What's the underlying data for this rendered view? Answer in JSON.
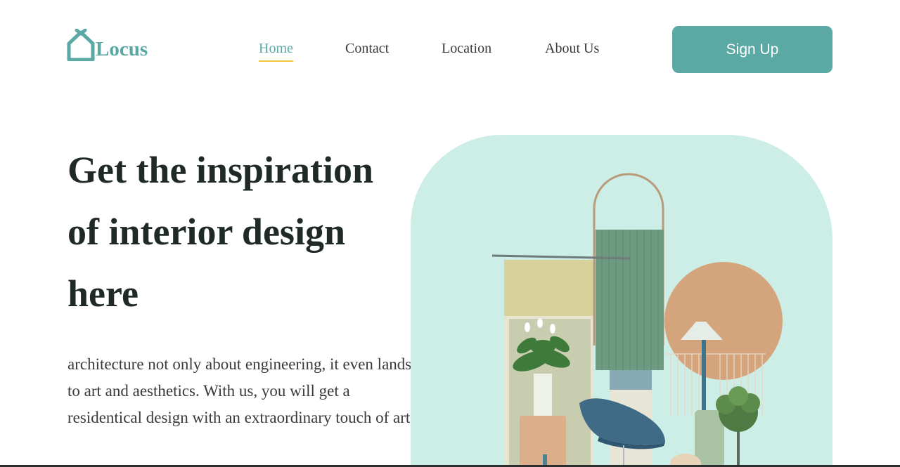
{
  "brand": {
    "name": "Locus",
    "icon": "house-icon"
  },
  "nav": {
    "items": [
      {
        "label": "Home",
        "active": true
      },
      {
        "label": "Contact",
        "active": false
      },
      {
        "label": "Location",
        "active": false
      },
      {
        "label": "About Us",
        "active": false
      }
    ]
  },
  "signup": {
    "label": "Sign Up"
  },
  "hero": {
    "title_lines": [
      "Get the inspiration",
      "of interior design",
      "here"
    ],
    "description": "architecture not only about engineering, it even lands to art and aesthetics. With us, you will get a residentical design with an extraordinary touch of art."
  },
  "colors": {
    "accent": "#5aa9a4",
    "underline": "#f2c744",
    "image_background": "#cdeee6",
    "text_dark": "#1f2a28"
  }
}
